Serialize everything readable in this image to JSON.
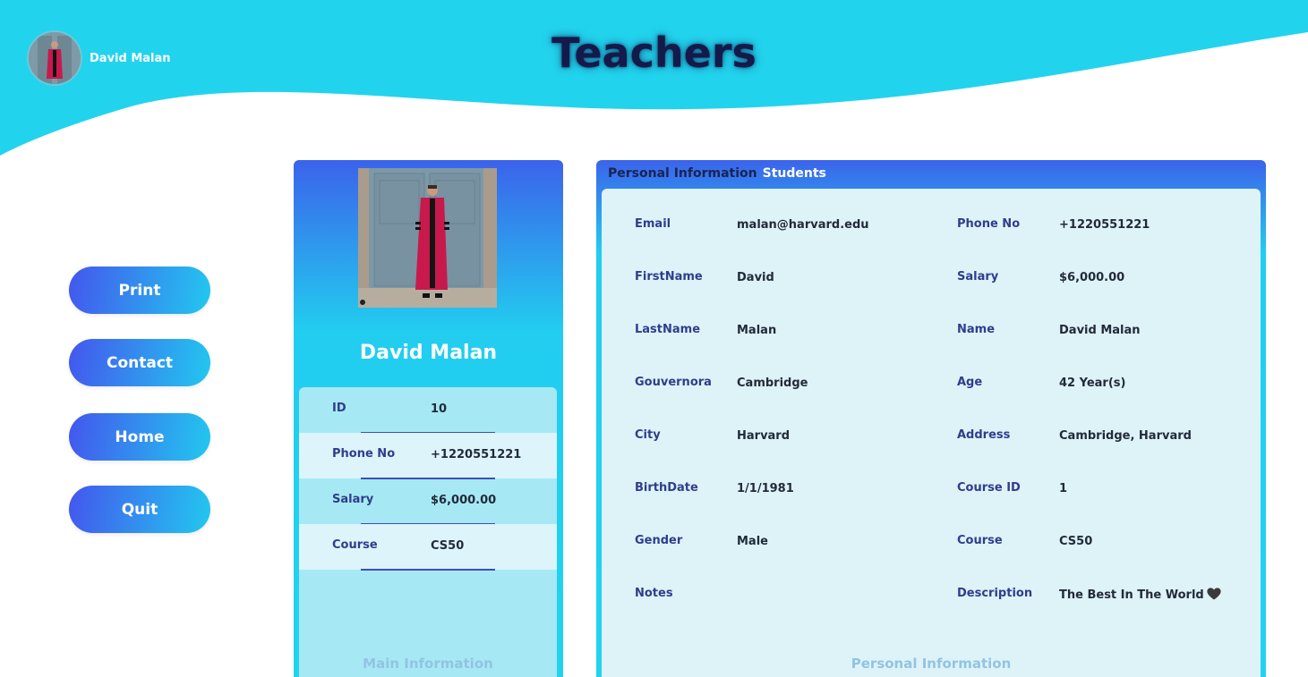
{
  "header": {
    "title": "Teachers",
    "user_name": "David Malan"
  },
  "nav": {
    "buttons": [
      {
        "label": "Print"
      },
      {
        "label": "Contact"
      },
      {
        "label": "Home"
      },
      {
        "label": "Quit"
      }
    ]
  },
  "main_card": {
    "name": "David Malan",
    "rows": [
      {
        "label": "ID",
        "value": "10"
      },
      {
        "label": "Phone No",
        "value": "+1220551221"
      },
      {
        "label": "Salary",
        "value": "$6,000.00"
      },
      {
        "label": "Course",
        "value": "CS50"
      }
    ],
    "footer": "Main Information"
  },
  "personal": {
    "tabs": [
      {
        "label": "Personal Information",
        "active": true
      },
      {
        "label": "Students",
        "active": false
      }
    ],
    "left_fields": [
      {
        "label": "Email",
        "value": "malan@harvard.edu"
      },
      {
        "label": "FirstName",
        "value": "David"
      },
      {
        "label": "LastName",
        "value": "Malan"
      },
      {
        "label": "Gouvernora",
        "value": "Cambridge"
      },
      {
        "label": "City",
        "value": "Harvard"
      },
      {
        "label": "BirthDate",
        "value": "1/1/1981"
      },
      {
        "label": "Gender",
        "value": "Male"
      },
      {
        "label": "Notes",
        "value": ""
      }
    ],
    "right_fields": [
      {
        "label": "Phone No",
        "value": "+1220551221"
      },
      {
        "label": "Salary",
        "value": "$6,000.00"
      },
      {
        "label": "Name",
        "value": "David Malan"
      },
      {
        "label": "Age",
        "value": "42 Year(s)"
      },
      {
        "label": "Address",
        "value": "Cambridge, Harvard"
      },
      {
        "label": "Course ID",
        "value": "1"
      },
      {
        "label": "Course",
        "value": "CS50"
      },
      {
        "label": "Description",
        "value": "The Best In The World"
      }
    ],
    "footer": "Personal Information"
  },
  "colors": {
    "header_cyan": "#22d3ee",
    "title_navy": "#141a4a",
    "button_blue": "#4456ee",
    "label_blue": "#2f3d8c"
  }
}
